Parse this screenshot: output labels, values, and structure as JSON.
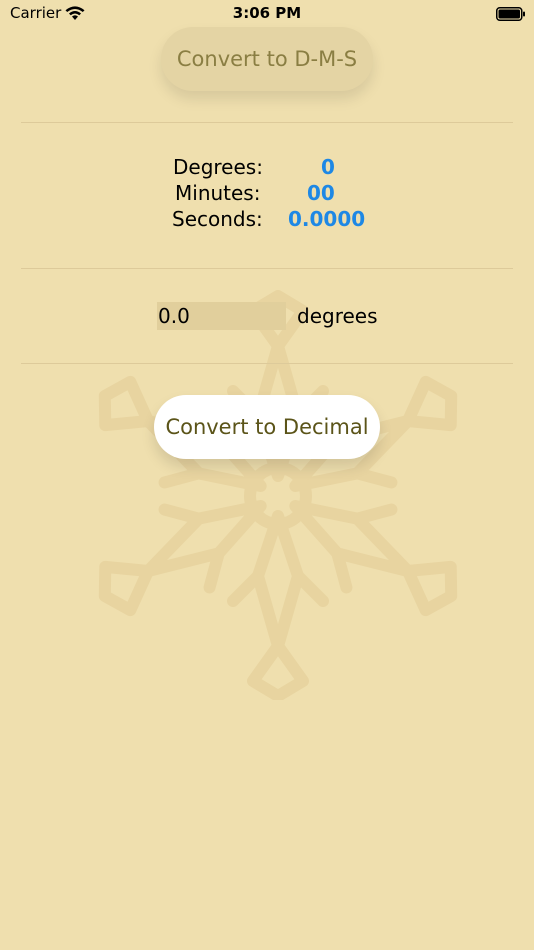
{
  "status_bar": {
    "carrier": "Carrier",
    "time": "3:06 PM",
    "wifi_icon": "wifi-icon",
    "battery_icon": "battery-icon"
  },
  "buttons": {
    "convert_dms": "Convert to D-M-S",
    "convert_decimal": "Convert to Decimal"
  },
  "dms": {
    "degrees_label": "Degrees:",
    "minutes_label": "Minutes:",
    "seconds_label": "Seconds:",
    "degrees_value": "0",
    "minutes_value": "00",
    "seconds_value": "0.0000"
  },
  "decimal": {
    "value": "0.0",
    "unit_label": "degrees"
  },
  "colors": {
    "background": "#efdfae",
    "value_accent": "#1e88e5",
    "button_text_dms": "#8a7e43",
    "button_text_decimal": "#5b5419"
  },
  "background_icon": "snowflake-icon"
}
